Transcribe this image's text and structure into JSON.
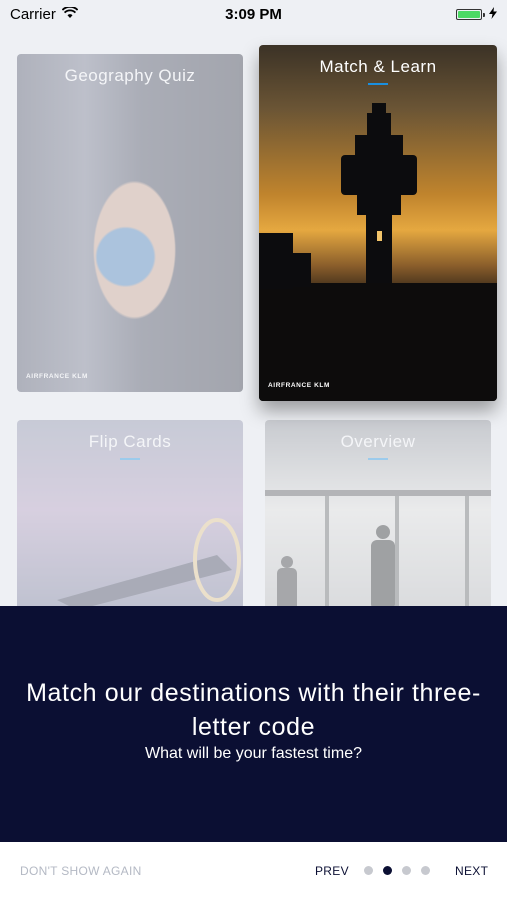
{
  "status_bar": {
    "carrier": "Carrier",
    "time": "3:09 PM",
    "wifi_icon": "wifi-icon",
    "battery_icon": "battery-icon",
    "charging_icon": "bolt-icon",
    "battery_color": "#4cd964"
  },
  "cards": {
    "geo": {
      "title": "Geography Quiz",
      "logo": "AIRFRANCE KLM",
      "selected": false
    },
    "match": {
      "title": "Match & Learn",
      "logo": "AIRFRANCE KLM",
      "selected": true
    },
    "flip": {
      "title": "Flip Cards",
      "selected": false
    },
    "overview": {
      "title": "Overview",
      "selected": false
    }
  },
  "panel": {
    "headline": "Match our destinations with their three-letter code",
    "subtitle": "What will be your fastest time?",
    "background": "#0b0f33"
  },
  "footer": {
    "dont_show": "DON'T SHOW AGAIN",
    "prev": "PREV",
    "next": "NEXT",
    "page_count": 4,
    "current_page": 2
  },
  "colors": {
    "accent": "#1a90e0",
    "navy": "#0b0f33"
  }
}
